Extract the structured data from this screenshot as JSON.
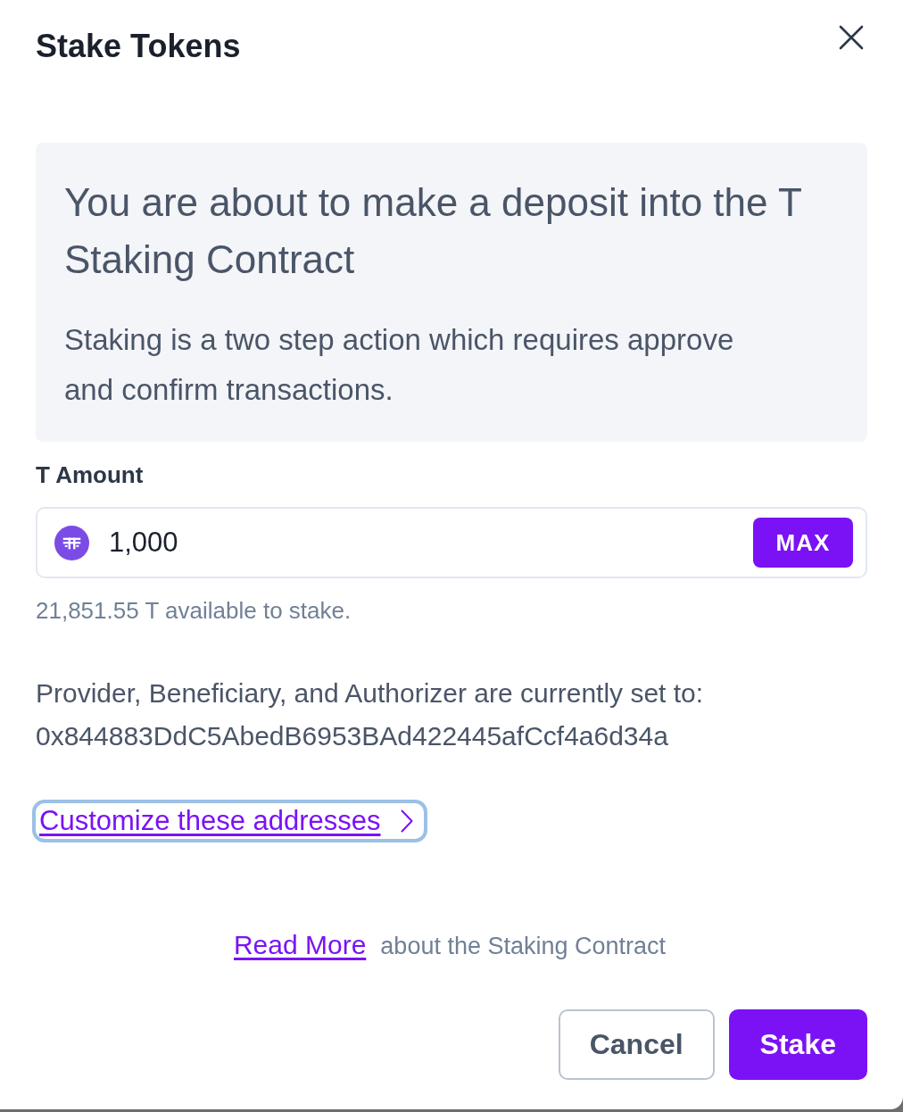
{
  "dialog": {
    "title": "Stake Tokens"
  },
  "info": {
    "heading": "You are about to make a deposit into the T Staking Contract",
    "text": "Staking is a two step action which requires approve and confirm transactions."
  },
  "amount": {
    "label": "T Amount",
    "value": "1,000",
    "max_button": "MAX",
    "helper": "21,851.55 T available to stake."
  },
  "addresses": {
    "text": "Provider, Beneficiary, and Authorizer are currently set to:",
    "address": "0x844883DdC5AbedB6953BAd422445afCcf4a6d34a",
    "link": {
      "label": "Customize these addresses",
      "focused": true
    }
  },
  "footer_note": {
    "link": "Read More",
    "text": "about the Staking Contract"
  },
  "buttons": [
    {
      "label": "Cancel",
      "kind": "secondary"
    },
    {
      "label": "Stake",
      "kind": "primary"
    }
  ]
}
